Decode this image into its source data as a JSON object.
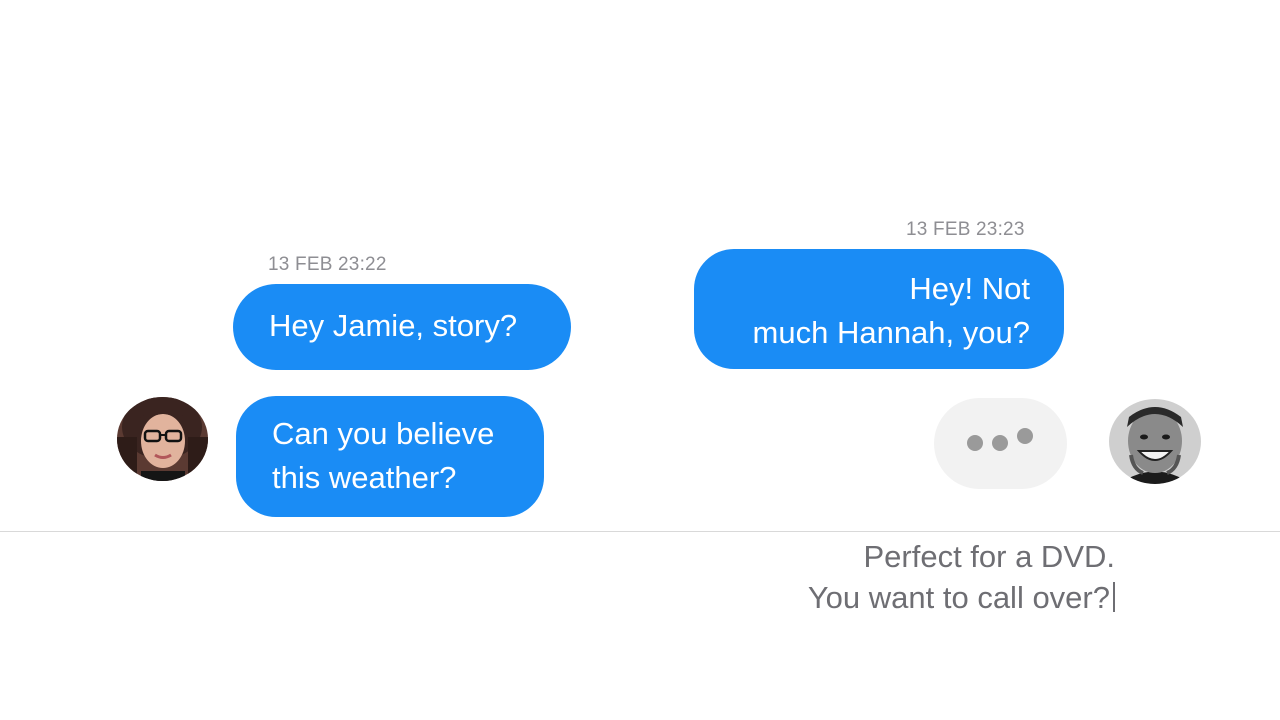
{
  "conversation": {
    "left": {
      "timestamp": "13 FEB 23:22",
      "messages": [
        {
          "lines": [
            "Hey Jamie, story?"
          ]
        },
        {
          "lines": [
            "Can you believe",
            "this weather?"
          ]
        }
      ]
    },
    "right": {
      "timestamp": "13 FEB 23:23",
      "messages": [
        {
          "lines": [
            "Hey! Not",
            "much Hannah, you?"
          ]
        }
      ]
    }
  },
  "composer": {
    "draft_lines": [
      "Perfect for a DVD.",
      "You want to call over?"
    ]
  },
  "colors": {
    "bubble_blue": "#1a8cf5",
    "typing_bubble": "#f2f2f2",
    "timestamp_gray": "#8e8e93",
    "draft_text_gray": "#6e6e73",
    "divider": "#d9d9d9"
  },
  "icons": {
    "left_avatar": "woman-with-glasses-avatar",
    "right_avatar": "smiling-man-avatar",
    "typing": "typing-indicator-dots"
  }
}
